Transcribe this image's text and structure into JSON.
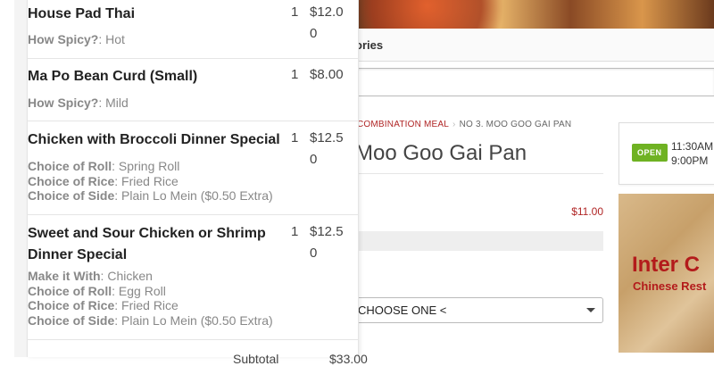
{
  "page": {
    "tabs_fragment": "ories",
    "breadcrumb": {
      "category": "COMBINATION MEAL",
      "current": "NO 3. MOO GOO GAI PAN"
    },
    "product_title": "Moo Goo Gai Pan",
    "price": "$11.00",
    "select_value": "CHOOSE ONE <",
    "hours": {
      "badge": "OPEN",
      "open": "11:30AM",
      "close": "9:00PM"
    },
    "promo": {
      "line1": "Inter C",
      "line2": "Chinese Rest"
    }
  },
  "cart": {
    "items": [
      {
        "name": "House Pad Thai",
        "qty": "1",
        "price": "$12.00",
        "options": [
          {
            "k": "How Spicy?",
            "v": "Hot"
          }
        ]
      },
      {
        "name": "Ma Po Bean Curd (Small)",
        "qty": "1",
        "price": "$8.00",
        "options": [
          {
            "k": "How Spicy?",
            "v": "Mild"
          }
        ]
      },
      {
        "name": "Chicken with Broccoli Dinner Special",
        "qty": "1",
        "price": "$12.50",
        "options": [
          {
            "k": "Choice of Roll",
            "v": "Spring Roll"
          },
          {
            "k": "Choice of Rice",
            "v": "Fried Rice"
          },
          {
            "k": "Choice of Side",
            "v": "Plain Lo Mein ($0.50 Extra)"
          }
        ]
      },
      {
        "name": "Sweet and Sour Chicken or Shrimp Dinner Special",
        "qty": "1",
        "price": "$12.50",
        "options": [
          {
            "k": "Make it With",
            "v": "Chicken"
          },
          {
            "k": "Choice of Roll",
            "v": "Egg Roll"
          },
          {
            "k": "Choice of Rice",
            "v": "Fried Rice"
          },
          {
            "k": "Choice of Side",
            "v": "Plain Lo Mein ($0.50 Extra)"
          }
        ]
      }
    ],
    "subtotal_label": "Subtotal",
    "subtotal_value": "$33.00"
  },
  "colors": {
    "accent": "#b02525",
    "open_badge": "#6fb223"
  }
}
